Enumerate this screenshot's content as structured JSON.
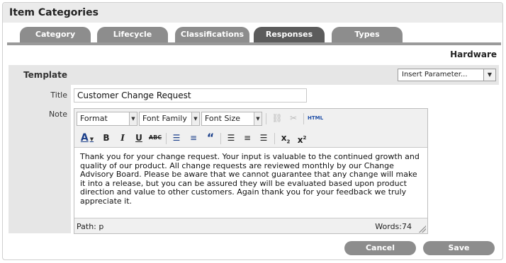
{
  "header": {
    "title": "Item Categories"
  },
  "tabs": [
    {
      "label": "Category"
    },
    {
      "label": "Lifecycle"
    },
    {
      "label": "Classifications"
    },
    {
      "label": "Responses",
      "active": true
    },
    {
      "label": "Types"
    }
  ],
  "context": {
    "label": "Hardware"
  },
  "template": {
    "label": "Template",
    "insert_parameter": "Insert Parameter..."
  },
  "form": {
    "title_label": "Title",
    "title_value": "Customer Change Request",
    "note_label": "Note"
  },
  "editor": {
    "format": "Format",
    "font_family": "Font Family",
    "font_size": "Font Size",
    "html_label": "HTML",
    "content": "Thank you for your change request. Your input is valuable to the continued growth and quality of our product. All change requests are reviewed monthly by our Change Advisory Board. Please be aware that we cannot guarantee that any change will make it into a release, but you can be assured they will be evaluated based upon product direction and value to other customers. Again thank you for your feedback we truly appreciate it.",
    "path": "Path: p",
    "words": "Words:74"
  },
  "actions": {
    "cancel": "Cancel",
    "save": "Save"
  }
}
